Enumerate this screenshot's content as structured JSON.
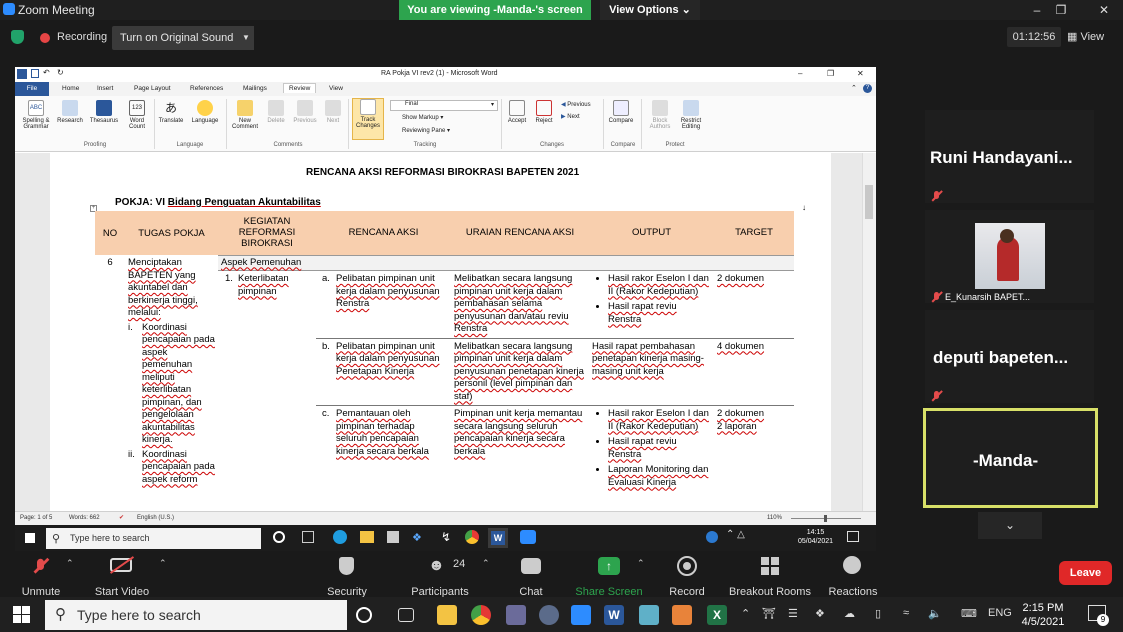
{
  "zoom": {
    "window_title": "Zoom Meeting",
    "viewing_banner": "You are viewing -Manda-'s screen",
    "view_options": "View Options",
    "recording_label": "Recording",
    "original_sound": "Turn on Original Sound",
    "timer": "01:12:56",
    "view_label": "View",
    "participants_count": "24",
    "controls": {
      "unmute": "Unmute",
      "start_video": "Start Video",
      "security": "Security",
      "participants": "Participants",
      "chat": "Chat",
      "share_screen": "Share Screen",
      "record": "Record",
      "breakout_rooms": "Breakout Rooms",
      "reactions": "Reactions",
      "leave": "Leave"
    },
    "gallery": [
      {
        "name": "Runi  Handayani..."
      },
      {
        "name": "E_Kunarsih BAPET..."
      },
      {
        "name": "deputi  bapeten..."
      },
      {
        "name": "-Manda-"
      }
    ],
    "colors": {
      "banner": "#2da44e",
      "leave": "#e02828",
      "active_speaker": "#d8e068",
      "share": "#2da44e"
    }
  },
  "word": {
    "title": "RA Pokja VI rev2 (1)  -  Microsoft Word",
    "tabs": [
      "File",
      "Home",
      "Insert",
      "Page Layout",
      "References",
      "Mailings",
      "Review",
      "View"
    ],
    "ribbon": {
      "buttons": [
        "Spelling & Grammar",
        "Research",
        "Thesaurus",
        "Word Count",
        "Translate",
        "Language",
        "New Comment",
        "Delete",
        "Previous",
        "Next",
        "Track Changes",
        "Accept",
        "Reject",
        "Compare",
        "Block Authors",
        "Restrict Editing"
      ],
      "final": "Final",
      "show_markup": "Show Markup",
      "reviewing_pane": "Reviewing Pane",
      "previous": "Previous",
      "next": "Next",
      "groups": [
        "Proofing",
        "Language",
        "Comments",
        "Tracking",
        "Changes",
        "Compare",
        "Protect"
      ]
    },
    "status": {
      "page": "Page: 1 of 5",
      "words": "Words: 662",
      "language": "English (U.S.)",
      "zoom": "110%"
    },
    "document": {
      "title": "RENCANA AKSI REFORMASI BIROKRASI BAPETEN 2021",
      "pokja_prefix": "POKJA: VI ",
      "pokja_name": "Bidang Penguatan Akuntabilitas",
      "headers": [
        "NO",
        "TUGAS POKJA",
        "KEGIATAN REFORMASI BIROKRASI",
        "RENCANA AKSI",
        "URAIAN RENCANA AKSI",
        "OUTPUT",
        "TARGET"
      ],
      "no": "6",
      "tugas_intro": "Menciptakan BAPETEN yang akuntabel dan berkinerja tinggi, melalui:",
      "tugas_items": [
        {
          "num": "i.",
          "text": "Koordinasi pencapaian pada aspek pemenuhan meliputi keterlibatan pimpinan, dan pengelolaan akuntabilitas kinerja."
        },
        {
          "num": "ii.",
          "text": "Koordinasi pencapaian pada aspek reform"
        }
      ],
      "aspek": "Aspek Pemenuhan",
      "kegiatan_num": "1.",
      "kegiatan": "Keterlibatan pimpinan",
      "rows": [
        {
          "letter": "a.",
          "rencana": "Pelibatan pimpinan unit kerja dalam penyusunan Renstra",
          "uraian": "Melibatkan secara langsung pimpinan unit kerja dalam pembahasan selama penyusunan dan/atau reviu Renstra",
          "output": [
            "Hasil rakor Eselon I dan II (Rakor Kedeputian)",
            "Hasil rapat reviu Renstra"
          ],
          "target": [
            "2 dokumen"
          ]
        },
        {
          "letter": "b.",
          "rencana": "Pelibatan pimpinan unit kerja dalam penyusunan Penetapan Kinerja",
          "uraian": "Melibatkan secara langsung pimpinan unit kerja dalam penyusunan penetapan kinerja personil (level pimpinan dan staf)",
          "output_text": "Hasil rapat pembahasan penetapan kinerja masing-masing unit kerja",
          "target": [
            "4 dokumen"
          ]
        },
        {
          "letter": "c.",
          "rencana": "Pemantauan oleh pimpinan terhadap seluruh pencapaian kinerja secara berkala",
          "uraian": "Pimpinan unit kerja memantau secara langsung seluruh pencapaian kinerja secara berkala",
          "output": [
            "Hasil rakor Eselon I dan II (Rakor Kedeputian)",
            "Hasil rapat reviu Renstra",
            "Laporan Monitoring dan Evaluasi Kinerja"
          ],
          "target": [
            "2 dokumen",
            "2 laporan"
          ]
        }
      ]
    }
  },
  "inner_taskbar": {
    "search": "Type here to search",
    "time": "14:15",
    "date": "05/04/2021"
  },
  "host_taskbar": {
    "search": "Type here to search",
    "lang": "ENG",
    "time": "2:15 PM",
    "date": "4/5/2021",
    "notifications": "9"
  }
}
